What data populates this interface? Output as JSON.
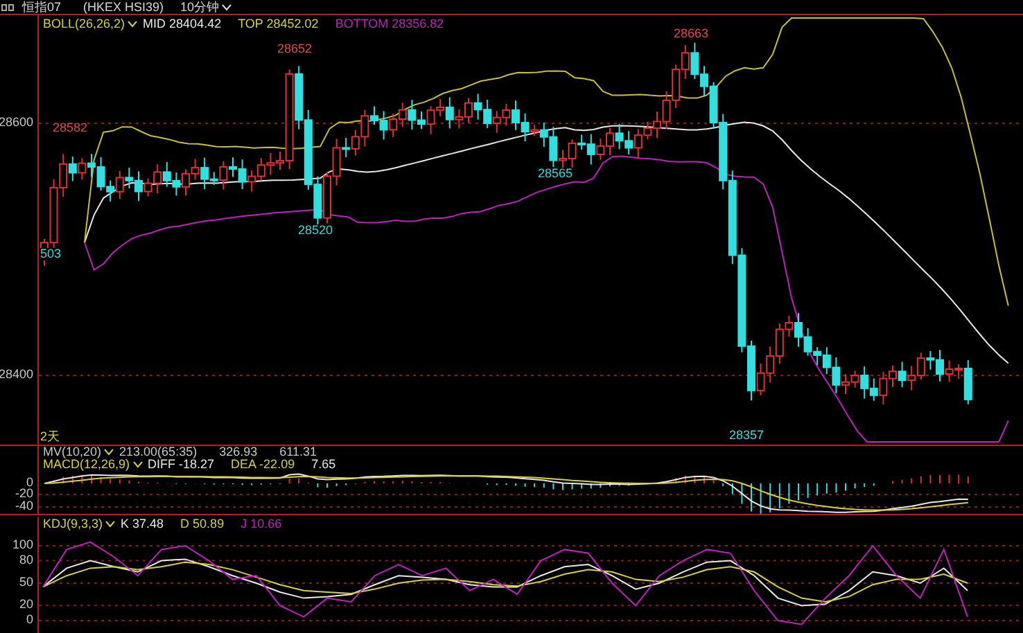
{
  "header": {
    "title": "恒指07",
    "code": "(HKEX HSI39)",
    "period": "10分钟"
  },
  "main": {
    "legend": {
      "name": "BOLL(26,26,2)",
      "mid": "MID 28404.42",
      "top": "TOP 28452.02",
      "bottom": "BOTTOM 28356.82"
    },
    "yticks": [
      "28600",
      "28400"
    ],
    "price_labels": [
      {
        "text": "28582",
        "kind": "high"
      },
      {
        "text": "28652",
        "kind": "high"
      },
      {
        "text": "28520",
        "kind": "low"
      },
      {
        "text": "28565",
        "kind": "low"
      },
      {
        "text": "28663",
        "kind": "high"
      },
      {
        "text": "28357",
        "kind": "low"
      },
      {
        "text": "503",
        "kind": "low"
      }
    ],
    "range_label": "2天"
  },
  "volume_legend": {
    "name": "MV(10,20)",
    "values": [
      "213.00(65:35)",
      "326.93",
      "611.31"
    ]
  },
  "macd": {
    "legend": {
      "name": "MACD(12,26,9)",
      "diff": "DIFF -18.27",
      "dea": "DEA -22.09",
      "macd": "7.65"
    },
    "yticks": [
      "0",
      "-20",
      "-40"
    ]
  },
  "kdj": {
    "legend": {
      "name": "KDJ(9,3,3)",
      "readings": [
        "37.48",
        "50.89",
        "10.66"
      ]
    },
    "chart_data": {
      "type": "line",
      "ylim": [
        -16.7,
        140.7
      ],
      "yticks": [
        100,
        80,
        50,
        20,
        0
      ],
      "grid": true,
      "series": [
        {
          "name": "K",
          "color": "#e8e8e8",
          "values": [
            45,
            70,
            80,
            72,
            65,
            80,
            82,
            72,
            60,
            50,
            38,
            30,
            32,
            35,
            48,
            60,
            58,
            55,
            48,
            45,
            45,
            60,
            72,
            75,
            60,
            42,
            50,
            65,
            78,
            80,
            60,
            30,
            20,
            22,
            40,
            65,
            60,
            50,
            70,
            40
          ]
        },
        {
          "name": "D",
          "color": "#d8d040",
          "values": [
            45,
            60,
            70,
            72,
            68,
            72,
            78,
            75,
            68,
            58,
            48,
            40,
            38,
            36,
            42,
            50,
            54,
            55,
            52,
            48,
            46,
            52,
            62,
            68,
            65,
            55,
            52,
            58,
            68,
            72,
            65,
            45,
            30,
            25,
            32,
            48,
            55,
            55,
            62,
            50
          ]
        },
        {
          "name": "J",
          "color": "#c020c0",
          "values": [
            45,
            95,
            105,
            85,
            60,
            95,
            100,
            80,
            55,
            60,
            20,
            5,
            30,
            25,
            60,
            75,
            60,
            70,
            40,
            55,
            35,
            80,
            95,
            90,
            50,
            20,
            60,
            80,
            95,
            90,
            40,
            0,
            -5,
            30,
            60,
            100,
            60,
            30,
            95,
            5
          ]
        }
      ]
    }
  }
}
